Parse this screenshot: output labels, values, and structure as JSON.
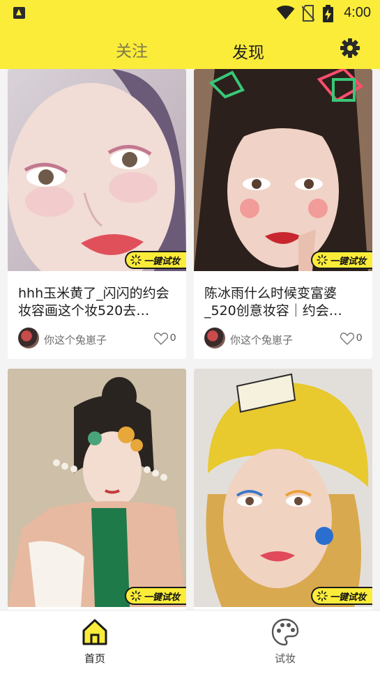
{
  "status_bar": {
    "time": "4:00",
    "icons": [
      "app-notification-icon",
      "wifi-icon",
      "no-sim-icon",
      "battery-charging-icon"
    ]
  },
  "header": {
    "tabs": [
      {
        "label": "关注",
        "active": false
      },
      {
        "label": "发现",
        "active": true
      }
    ],
    "settings_icon": "gear-icon",
    "background_color": "#fbec3a"
  },
  "feed": {
    "badge_label": "一键试妆",
    "badge_icon": "sparkle-icon",
    "cards": [
      {
        "title": "hhh玉米黄了_闪闪的约会妆容画这个妆520去…",
        "author": "你这个兔崽子",
        "likes": "0"
      },
      {
        "title": "陈冰雨什么时候变富婆_520创意妆容｜约会…",
        "author": "你这个兔崽子",
        "likes": "0"
      },
      {
        "title": "",
        "author": "",
        "likes": ""
      },
      {
        "title": "",
        "author": "",
        "likes": ""
      }
    ]
  },
  "bottom_nav": {
    "items": [
      {
        "label": "首页",
        "icon": "home-icon",
        "active": true
      },
      {
        "label": "试妆",
        "icon": "palette-icon",
        "active": false
      }
    ]
  }
}
